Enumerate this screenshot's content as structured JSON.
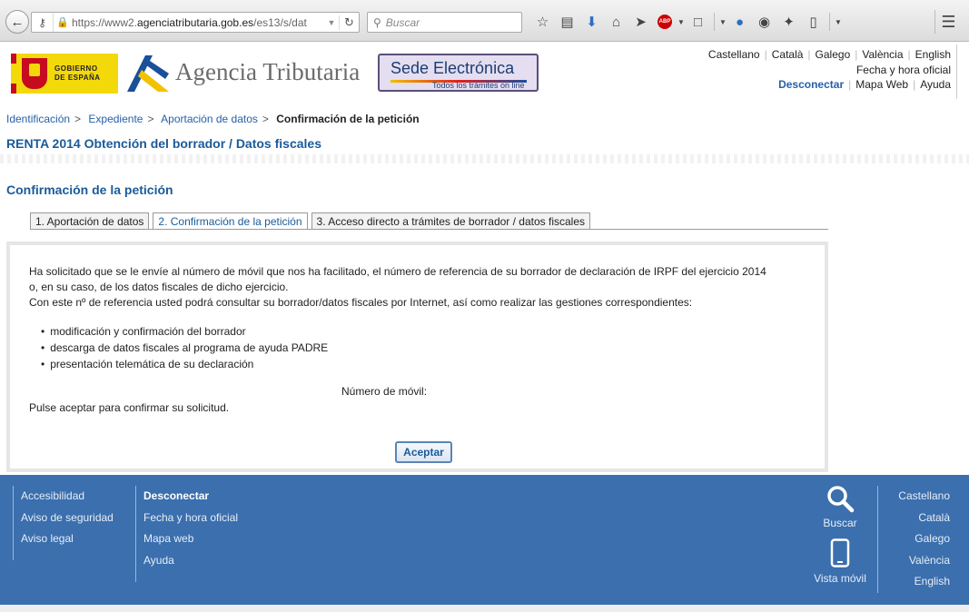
{
  "browser": {
    "url_prefix": "https://www2.",
    "url_domain": "agenciatributaria.gob.es",
    "url_suffix": "/es13/s/dat",
    "search_placeholder": "Buscar"
  },
  "header": {
    "gob_line1": "GOBIERNO",
    "gob_line2": "DE ESPAÑA",
    "site_title": "Agencia Tributaria",
    "sede_title": "Sede Electrónica",
    "sede_subtitle": "Todos los trámites on line",
    "languages": [
      "Castellano",
      "Català",
      "Galego",
      "València",
      "English"
    ],
    "official_time": "Fecha y hora oficial",
    "disconnect": "Desconectar",
    "site_map": "Mapa Web",
    "help": "Ayuda"
  },
  "breadcrumb": {
    "items": [
      "Identificación",
      "Expediente",
      "Aportación de datos"
    ],
    "current": "Confirmación de la petición"
  },
  "page_title": "RENTA 2014 Obtención del borrador / Datos fiscales",
  "section_title": "Confirmación de la petición",
  "tabs": [
    "1. Aportación de datos",
    "2. Confirmación de la petición",
    "3. Acceso directo a trámites de borrador / datos fiscales"
  ],
  "content": {
    "para1_line1": "Ha solicitado que se le envíe al número de móvil que nos ha facilitado, el número de referencia de su borrador de declaración de IRPF del ejercicio 2014",
    "para1_line2": "o, en su caso, de los datos fiscales de dicho ejercicio.",
    "para2": "Con este nº de referencia usted podrá consultar su borrador/datos fiscales por Internet, así como realizar las gestiones correspondientes:",
    "list": [
      "modificación y confirmación del borrador",
      "descarga de datos fiscales al programa de ayuda PADRE",
      "presentación telemática de su declaración"
    ],
    "mobile_label": "Número de móvil:",
    "confirm_text": "Pulse aceptar para confirmar su solicitud.",
    "accept_button": "Aceptar"
  },
  "footer": {
    "col1": [
      "Accesibilidad",
      "Aviso de seguridad",
      "Aviso legal"
    ],
    "col2": [
      "Desconectar",
      "Fecha y hora oficial",
      "Mapa web",
      "Ayuda"
    ],
    "search_label": "Buscar",
    "mobile_label": "Vista móvil",
    "languages": [
      "Castellano",
      "Català",
      "Galego",
      "València",
      "English"
    ]
  }
}
